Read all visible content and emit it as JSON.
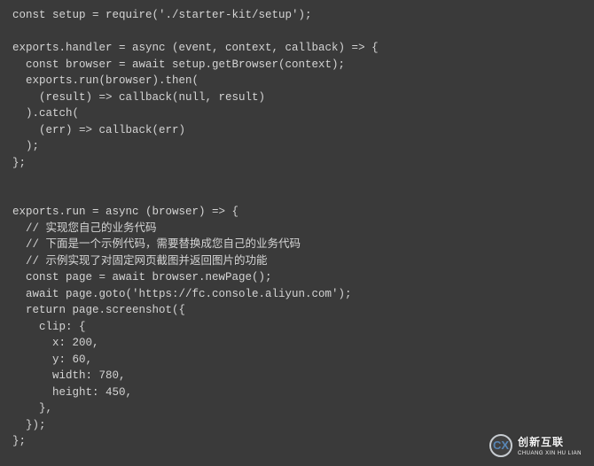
{
  "code": {
    "lines": [
      "const setup = require('./starter-kit/setup');",
      "",
      "exports.handler = async (event, context, callback) => {",
      "  const browser = await setup.getBrowser(context);",
      "  exports.run(browser).then(",
      "    (result) => callback(null, result)",
      "  ).catch(",
      "    (err) => callback(err)",
      "  );",
      "};",
      "",
      "",
      "exports.run = async (browser) => {",
      "  // 实现您自己的业务代码",
      "  // 下面是一个示例代码，需要替换成您自己的业务代码",
      "  // 示例实现了对固定网页截图并返回图片的功能",
      "  const page = await browser.newPage();",
      "  await page.goto('https://fc.console.aliyun.com');",
      "  return page.screenshot({",
      "    clip: {",
      "      x: 200,",
      "      y: 60,",
      "      width: 780,",
      "      height: 450,",
      "    },",
      "  });",
      "};"
    ]
  },
  "watermark": {
    "icon_text": "CX",
    "brand": "创新互联",
    "sub": "CHUANG XIN HU LIAN"
  }
}
